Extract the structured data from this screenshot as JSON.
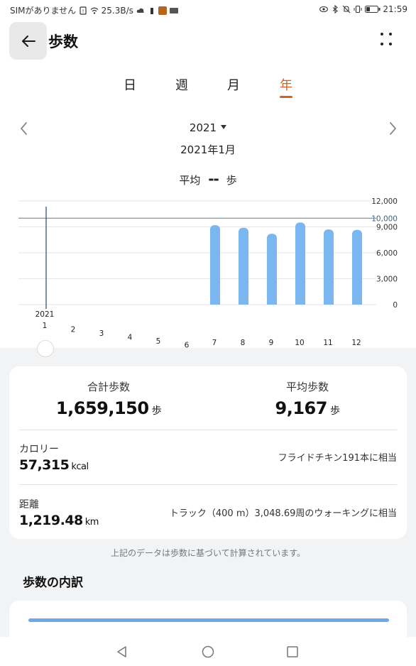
{
  "status_bar": {
    "carrier": "SIMがありません",
    "speed": "25.3B/s",
    "time": "21:59"
  },
  "header": {
    "title": "歩数"
  },
  "tabs": [
    {
      "label": "日",
      "active": false
    },
    {
      "label": "週",
      "active": false
    },
    {
      "label": "月",
      "active": false
    },
    {
      "label": "年",
      "active": true
    }
  ],
  "period": {
    "year": "2021",
    "selected": "2021年1月",
    "average_label": "平均",
    "average_value": "--",
    "average_unit": "歩"
  },
  "chart_data": {
    "type": "bar",
    "categories": [
      "1",
      "2",
      "3",
      "4",
      "5",
      "6",
      "7",
      "8",
      "9",
      "10",
      "11",
      "12"
    ],
    "x_year_label": "2021",
    "values": [
      0,
      0,
      0,
      0,
      0,
      0,
      9200,
      8900,
      8200,
      9500,
      8700,
      8650
    ],
    "ylim": [
      0,
      12000
    ],
    "yticks": [
      "12,000",
      "10,000",
      "9,000",
      "6,000",
      "3,000",
      "0"
    ],
    "ytick_values": [
      12000,
      10000,
      9000,
      6000,
      3000,
      0
    ],
    "target_line": 10000,
    "selected_index": 0,
    "bar_color": "#7ab7f0",
    "grid": true
  },
  "summary": {
    "total_label": "合計歩数",
    "total_value": "1,659,150",
    "total_unit": "歩",
    "avg_label": "平均歩数",
    "avg_value": "9,167",
    "avg_unit": "歩"
  },
  "calories": {
    "label": "カロリー",
    "value": "57,315",
    "unit": "kcal",
    "equivalent": "フライドチキン191本に相当"
  },
  "distance": {
    "label": "距離",
    "value": "1,219.48",
    "unit": "km",
    "equivalent": "トラック（400 m）3,048.69周のウォーキングに相当"
  },
  "footnote": "上記のデータは歩数に基づいて計算されています。",
  "breakdown": {
    "title": "歩数の内訳"
  },
  "colors": {
    "accent": "#d4621f",
    "bar": "#7ab7f0",
    "target_line": "#6f8ca8"
  }
}
